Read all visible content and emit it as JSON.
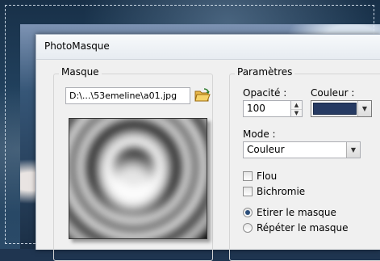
{
  "dialog": {
    "title": "PhotoMasque"
  },
  "masque": {
    "group_label": "Masque",
    "file_path": "D:\\...\\53emeline\\a01.jpg"
  },
  "parametres": {
    "group_label": "Paramètres",
    "opacite_label": "Opacité :",
    "opacite_value": "100",
    "couleur_label": "Couleur :",
    "couleur_value": "#263a62",
    "mode_label": "Mode :",
    "mode_value": "Couleur",
    "flou_label": "Flou",
    "flou_checked": false,
    "bichromie_label": "Bichromie",
    "bichromie_checked": false,
    "etirer_label": "Etirer le masque",
    "etirer_selected": true,
    "repeter_label": "Répéter le masque",
    "repeter_selected": false
  },
  "icons": {
    "browse": "open-folder-icon",
    "spin_up": "spin-up-icon",
    "spin_down": "spin-down-icon",
    "dropdown": "chevron-down-icon"
  }
}
